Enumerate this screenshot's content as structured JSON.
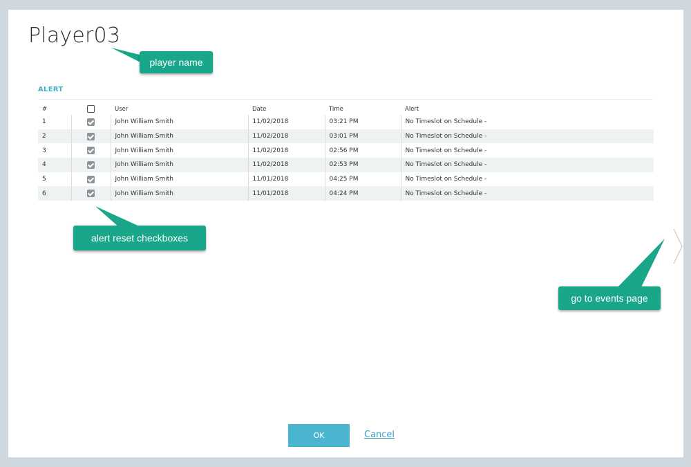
{
  "player": {
    "name": "Player03"
  },
  "alert_section": {
    "title": "ALERT",
    "columns": [
      "#",
      "",
      "User",
      "Date",
      "Time",
      "Alert"
    ],
    "rows": [
      {
        "num": "1",
        "checked": true,
        "user": "John William Smith",
        "date": "11/02/2018",
        "time": "03:21 PM",
        "alert": "No Timeslot on Schedule -"
      },
      {
        "num": "2",
        "checked": true,
        "user": "John William Smith",
        "date": "11/02/2018",
        "time": "03:01 PM",
        "alert": "No Timeslot on Schedule -"
      },
      {
        "num": "3",
        "checked": true,
        "user": "John William Smith",
        "date": "11/02/2018",
        "time": "02:56 PM",
        "alert": "No Timeslot on Schedule -"
      },
      {
        "num": "4",
        "checked": true,
        "user": "John William Smith",
        "date": "11/02/2018",
        "time": "02:53 PM",
        "alert": "No Timeslot on Schedule -"
      },
      {
        "num": "5",
        "checked": true,
        "user": "John William Smith",
        "date": "11/01/2018",
        "time": "04:25 PM",
        "alert": "No Timeslot on Schedule -"
      },
      {
        "num": "6",
        "checked": true,
        "user": "John William Smith",
        "date": "11/01/2018",
        "time": "04:24 PM",
        "alert": "No Timeslot on Schedule -"
      }
    ]
  },
  "callouts": {
    "player_name": "player name",
    "alert_reset": "alert reset checkboxes",
    "events_page": "go to events page"
  },
  "icons": {
    "next": "chevron-right-icon",
    "checkbox": "checkbox-icon"
  },
  "footer": {
    "ok_label": "OK",
    "cancel_label": "Cancel"
  },
  "colors": {
    "accent": "#3fb2c8",
    "callout": "#19a689",
    "ok_button": "#4ab5cf",
    "page_bg": "#cfd8de"
  }
}
